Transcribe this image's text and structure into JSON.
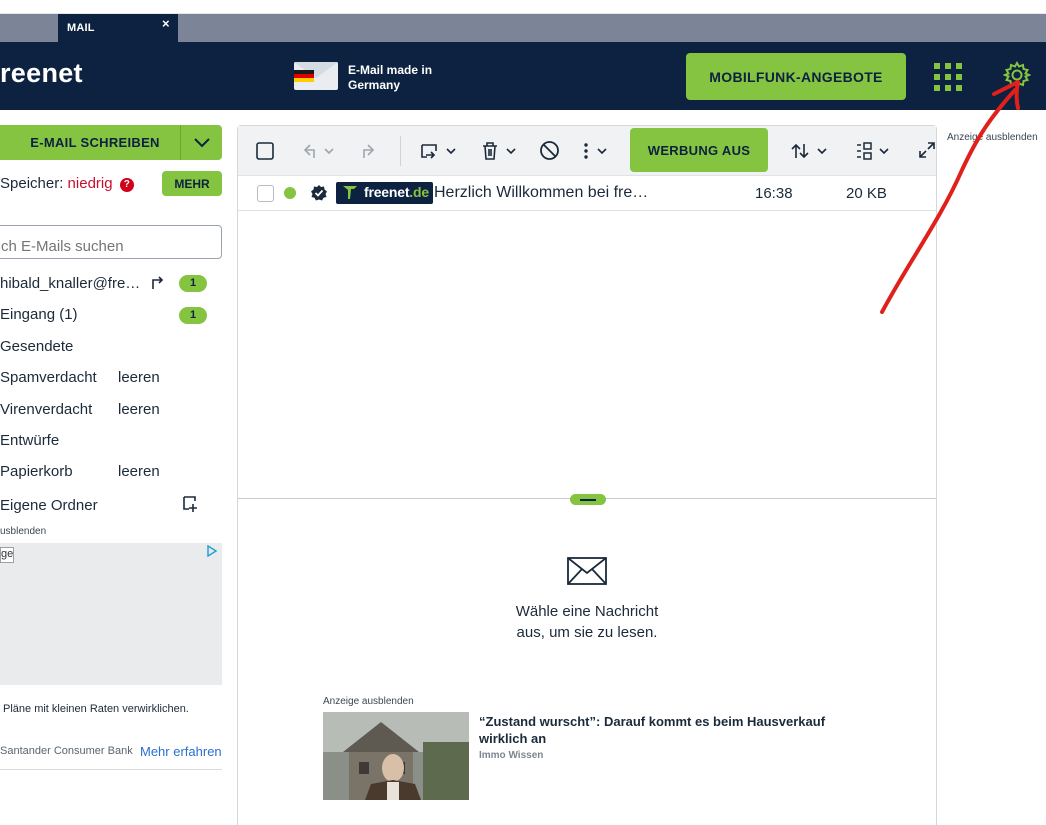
{
  "browser": {
    "tab_label": "MAIL",
    "tab_close": "×"
  },
  "header": {
    "logo": "reenet",
    "made_in": "E-Mail made in Germany",
    "mobilfunk_label": "MOBILFUNK-ANGEBOTE"
  },
  "sidebar": {
    "compose_label": "E-MAIL SCHREIBEN",
    "storage_label": "Speicher:",
    "storage_level": "niedrig",
    "storage_help": "?",
    "mehr_label": "MEHR",
    "search_placeholder": "ch E-Mails suchen",
    "account": {
      "label": "hibald_knaller@fre…",
      "count": "1"
    },
    "folders": [
      {
        "label": "Eingang (1)",
        "count": "1",
        "action": ""
      },
      {
        "label": "Gesendete",
        "count": "",
        "action": ""
      },
      {
        "label": "Spamverdacht",
        "count": "",
        "action": "leeren"
      },
      {
        "label": "Virenverdacht",
        "count": "",
        "action": "leeren"
      },
      {
        "label": "Entwürfe",
        "count": "",
        "action": ""
      },
      {
        "label": "Papierkorb",
        "count": "",
        "action": "leeren"
      }
    ],
    "own_folders_label": "Eigene Ordner",
    "ad_hide": "usblenden",
    "ad_box_text": "ge",
    "ad_caption": "Pläne mit kleinen Raten verwirklichen.",
    "ad_brand": "Santander Consumer Bank",
    "ad_link": "Mehr erfahren"
  },
  "toolbar": {
    "werbung_label": "WERBUNG AUS"
  },
  "mail_list": [
    {
      "sender_logo": "freenet",
      "sender_tld": ".de",
      "subject": "Herzlich Willkommen bei fre…",
      "time": "16:38",
      "size": "20 KB"
    }
  ],
  "reader": {
    "empty_line1": "Wähle eine Nachricht",
    "empty_line2": "aus, um sie zu lesen."
  },
  "ads": {
    "main_hide": "Anzeige ausblenden",
    "main_title": "“Zustand wurscht”: Darauf kommt es beim Hausverkauf wirklich an",
    "main_source": "Immo Wissen",
    "right_hide": "Anzeige ausblenden"
  },
  "colors": {
    "navy": "#0d2140",
    "green": "#84c440",
    "alert_red": "#c8102e",
    "annotation_red": "#e0201b"
  },
  "icons": [
    "close-icon",
    "envelope-flag-icon",
    "apps-grid-icon",
    "gear-icon",
    "chevron-down-icon",
    "forward-icon",
    "new-folder-icon",
    "ad-choices-icon",
    "checkbox-icon",
    "reply-icon",
    "redo-icon",
    "move-icon",
    "trash-icon",
    "block-icon",
    "more-icon",
    "sort-icon",
    "view-icon",
    "expand-icon",
    "verified-icon",
    "envelope-icon"
  ]
}
